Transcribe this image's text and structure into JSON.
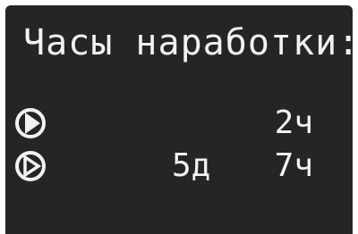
{
  "display": {
    "title": "Часы наработки:",
    "rows": [
      {
        "icon": "play-circle-icon",
        "days": "",
        "hours": "2ч"
      },
      {
        "icon": "play-outline-circle-icon",
        "days": "5д",
        "hours": "7ч"
      }
    ],
    "colors": {
      "background": "#252525",
      "text": "#f2f2f2"
    }
  }
}
